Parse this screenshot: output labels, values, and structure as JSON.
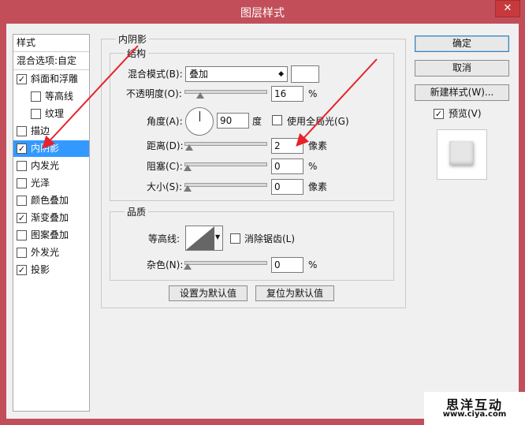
{
  "window": {
    "title": "图层样式",
    "close_label": "✕"
  },
  "left_panel": {
    "header": "样式",
    "blend_options": "混合选项:自定",
    "items": [
      {
        "label": "斜面和浮雕",
        "checked": true
      },
      {
        "label": "等高线",
        "checked": false
      },
      {
        "label": "纹理",
        "checked": false
      },
      {
        "label": "描边",
        "checked": false
      },
      {
        "label": "内阴影",
        "checked": true
      },
      {
        "label": "内发光",
        "checked": false
      },
      {
        "label": "光泽",
        "checked": false
      },
      {
        "label": "颜色叠加",
        "checked": false
      },
      {
        "label": "渐变叠加",
        "checked": true
      },
      {
        "label": "图案叠加",
        "checked": false
      },
      {
        "label": "外发光",
        "checked": false
      },
      {
        "label": "投影",
        "checked": true
      }
    ],
    "selected_index": 4
  },
  "inner_shadow": {
    "group_title": "内阴影",
    "structure": {
      "title": "结构",
      "blend_mode_label": "混合模式(B):",
      "blend_mode_value": "叠加",
      "opacity_label": "不透明度(O):",
      "opacity_value": "16",
      "opacity_unit": "%",
      "opacity_fraction": 0.16,
      "angle_label": "角度(A):",
      "angle_value": "90",
      "angle_unit": "度",
      "global_light_label": "使用全局光(G)",
      "global_light_checked": false,
      "distance_label": "距离(D):",
      "distance_value": "2",
      "distance_unit": "像素",
      "distance_fraction": 0.02,
      "choke_label": "阻塞(C):",
      "choke_value": "0",
      "choke_unit": "%",
      "size_label": "大小(S):",
      "size_value": "0",
      "size_unit": "像素"
    },
    "quality": {
      "title": "品质",
      "contour_label": "等高线:",
      "antialias_label": "消除锯齿(L)",
      "antialias_checked": false,
      "noise_label": "杂色(N):",
      "noise_value": "0",
      "noise_unit": "%"
    },
    "set_default_label": "设置为默认值",
    "reset_default_label": "复位为默认值"
  },
  "right_panel": {
    "ok_label": "确定",
    "cancel_label": "取消",
    "new_style_label": "新建样式(W)...",
    "preview_label": "预览(V)",
    "preview_checked": true
  },
  "watermark": {
    "line1": "思洋互动",
    "line2": "www.ciya.com"
  },
  "colors": {
    "titlebar": "#c24e5a",
    "selection": "#3399ff",
    "arrow": "#e8212b"
  }
}
